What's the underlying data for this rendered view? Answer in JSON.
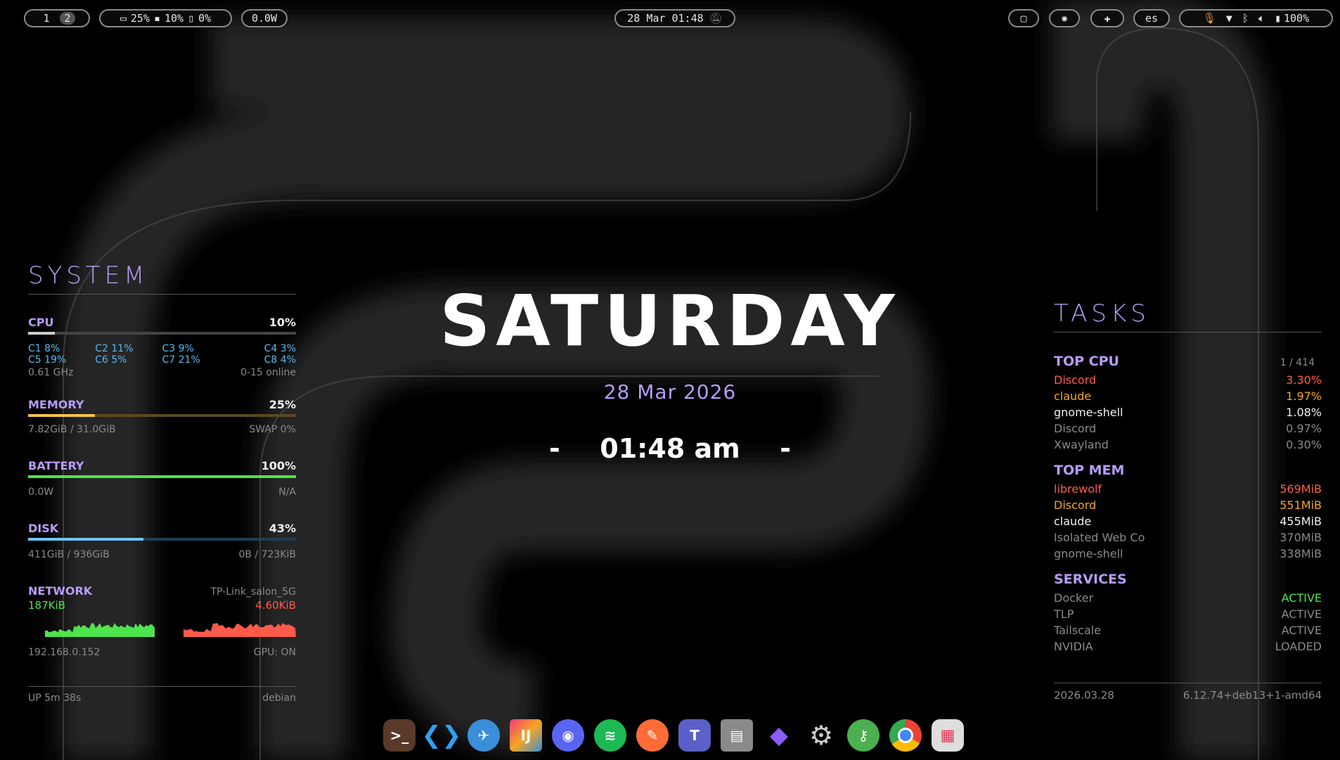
{
  "topbar": {
    "workspaces": [
      "1",
      "2"
    ],
    "active_workspace": "2",
    "cpu": "25%",
    "mem": "10%",
    "temp": "0%",
    "power": "0.0W",
    "clock": "28 Mar 01:48",
    "lang": "es",
    "battery": "100%"
  },
  "system": {
    "title": "SYSTEM",
    "cpu": {
      "label": "CPU",
      "pct": "10%",
      "fill": 0.1,
      "cores": [
        "C1 8%",
        "C2 11%",
        "C3 9%",
        "C4 3%",
        "C5 19%",
        "C6 5%",
        "C7 21%",
        "C8 4%"
      ],
      "freq": "0.61 GHz",
      "online": "0-15 online"
    },
    "memory": {
      "label": "MEMORY",
      "pct": "25%",
      "fill": 0.25,
      "used": "7.82GiB / 31.0GiB",
      "swap": "SWAP 0%"
    },
    "battery": {
      "label": "BATTERY",
      "pct": "100%",
      "fill": 1.0,
      "power": "0.0W",
      "state": "N/A"
    },
    "disk": {
      "label": "DISK",
      "pct": "43%",
      "fill": 0.43,
      "used": "411GiB / 936GiB",
      "io": "0B / 723KiB"
    },
    "network": {
      "label": "NETWORK",
      "ssid": "TP-Link_salon_5G",
      "down": "187KiB",
      "up": "4.60KiB",
      "ip": "192.168.0.152",
      "gpu": "GPU: ON"
    },
    "uptime": "UP 5m 38s",
    "distro": "debian"
  },
  "center": {
    "day": "SATURDAY",
    "date": "28 Mar 2026",
    "time": "01:48 am",
    "dash": "-"
  },
  "tasks": {
    "title": "TASKS",
    "top_cpu": {
      "label": "TOP CPU",
      "count": "1 / 414",
      "rows": [
        {
          "name": "Discord",
          "value": "3.30%",
          "color": "#ff5a4a"
        },
        {
          "name": "claude",
          "value": "1.97%",
          "color": "#f5a623"
        },
        {
          "name": "gnome-shell",
          "value": "1.08%",
          "color": "#f0f0f0"
        },
        {
          "name": "Discord",
          "value": "0.97%",
          "color": "#8a8a8a"
        },
        {
          "name": "Xwayland",
          "value": "0.30%",
          "color": "#8a8a8a"
        }
      ]
    },
    "top_mem": {
      "label": "TOP MEM",
      "rows": [
        {
          "name": "librewolf",
          "value": "569MiB",
          "color": "#ff5a4a"
        },
        {
          "name": "Discord",
          "value": "551MiB",
          "color": "#f5a623"
        },
        {
          "name": "claude",
          "value": "455MiB",
          "color": "#f0f0f0"
        },
        {
          "name": "Isolated Web Co",
          "value": "370MiB",
          "color": "#8a8a8a"
        },
        {
          "name": "gnome-shell",
          "value": "338MiB",
          "color": "#8a8a8a"
        }
      ]
    },
    "services": {
      "label": "SERVICES",
      "rows": [
        {
          "name": "Docker",
          "value": "ACTIVE",
          "color": "#4ee44e"
        },
        {
          "name": "TLP",
          "value": "ACTIVE",
          "color": "#8a8a8a"
        },
        {
          "name": "Tailscale",
          "value": "ACTIVE",
          "color": "#8a8a8a"
        },
        {
          "name": "NVIDIA",
          "value": "LOADED",
          "color": "#8a8a8a"
        }
      ]
    },
    "footer_date": "2026.03.28",
    "kernel": "6.12.74+deb13+1-amd64"
  },
  "dock": [
    "terminal-icon",
    "vscode-icon",
    "browser-icon",
    "intellij-icon",
    "discord-icon",
    "spotify-icon",
    "postman-icon",
    "teams-icon",
    "files-icon",
    "obsidian-icon",
    "settings-icon",
    "keys-icon",
    "chrome-icon",
    "apps-grid-icon"
  ],
  "colors": {
    "accent": "#b79cf7",
    "cpu_core": "#58b8f0",
    "memory": "#f5c542",
    "battery": "#4ee44e",
    "disk": "#6ec6f0",
    "down": "#4ee44e",
    "up": "#ff5a4a"
  }
}
